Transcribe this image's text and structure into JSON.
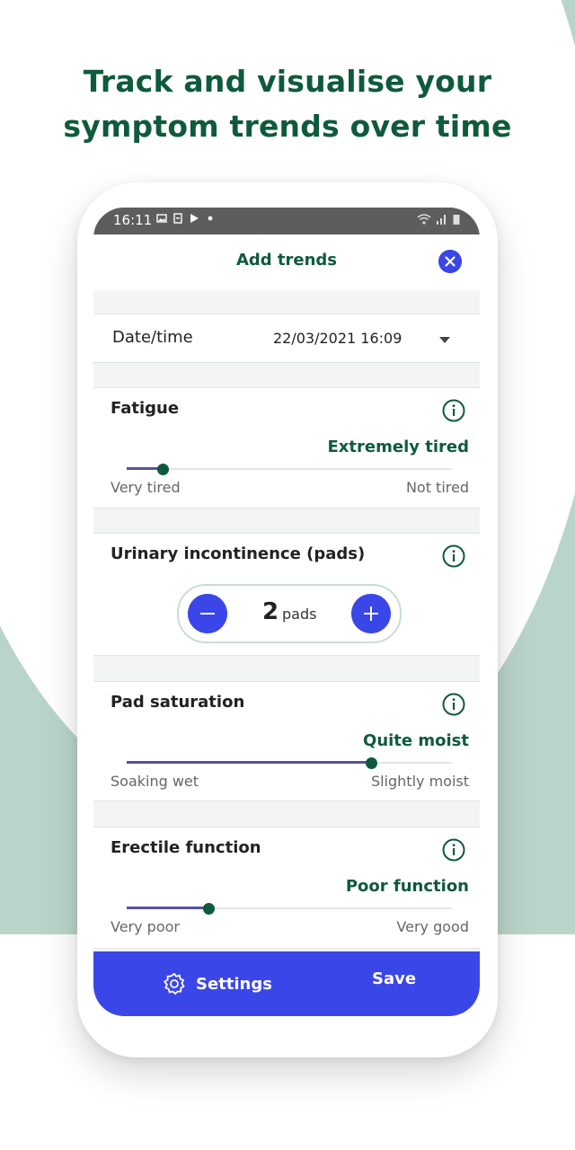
{
  "headline": {
    "strong": "Track",
    "rest_line1": " and visualise your",
    "line2": "symptom trends over time"
  },
  "status_bar": {
    "time": "16:11"
  },
  "header": {
    "title": "Add trends"
  },
  "date_row": {
    "label": "Date/time",
    "value": "22/03/2021 16:09"
  },
  "fatigue": {
    "title": "Fatigue",
    "value_label": "Extremely tired",
    "left_label": "Very tired",
    "right_label": "Not tired",
    "level": 0.11
  },
  "incontinence": {
    "title": "Urinary incontinence (pads)",
    "count": "2",
    "unit": "pads",
    "minus": "−",
    "plus": "+"
  },
  "saturation": {
    "title": "Pad saturation",
    "value_label": "Quite moist",
    "left_label": "Soaking wet",
    "right_label": "Slightly moist",
    "level": 0.75
  },
  "erectile": {
    "title": "Erectile function",
    "value_label": "Poor function",
    "left_label": "Very poor",
    "right_label": "Very good",
    "level": 0.25
  },
  "footer": {
    "settings_label": "Settings",
    "save_label": "Save"
  },
  "colors": {
    "brand_green": "#0e5a3c",
    "accent_blue": "#3b46e8",
    "background_green": "#b9d5c9",
    "slider_fill": "#5a4fa0"
  },
  "icons": {
    "close": "close-icon",
    "info": "info-icon",
    "settings": "gear-icon",
    "dropdown": "caret-down-icon"
  }
}
